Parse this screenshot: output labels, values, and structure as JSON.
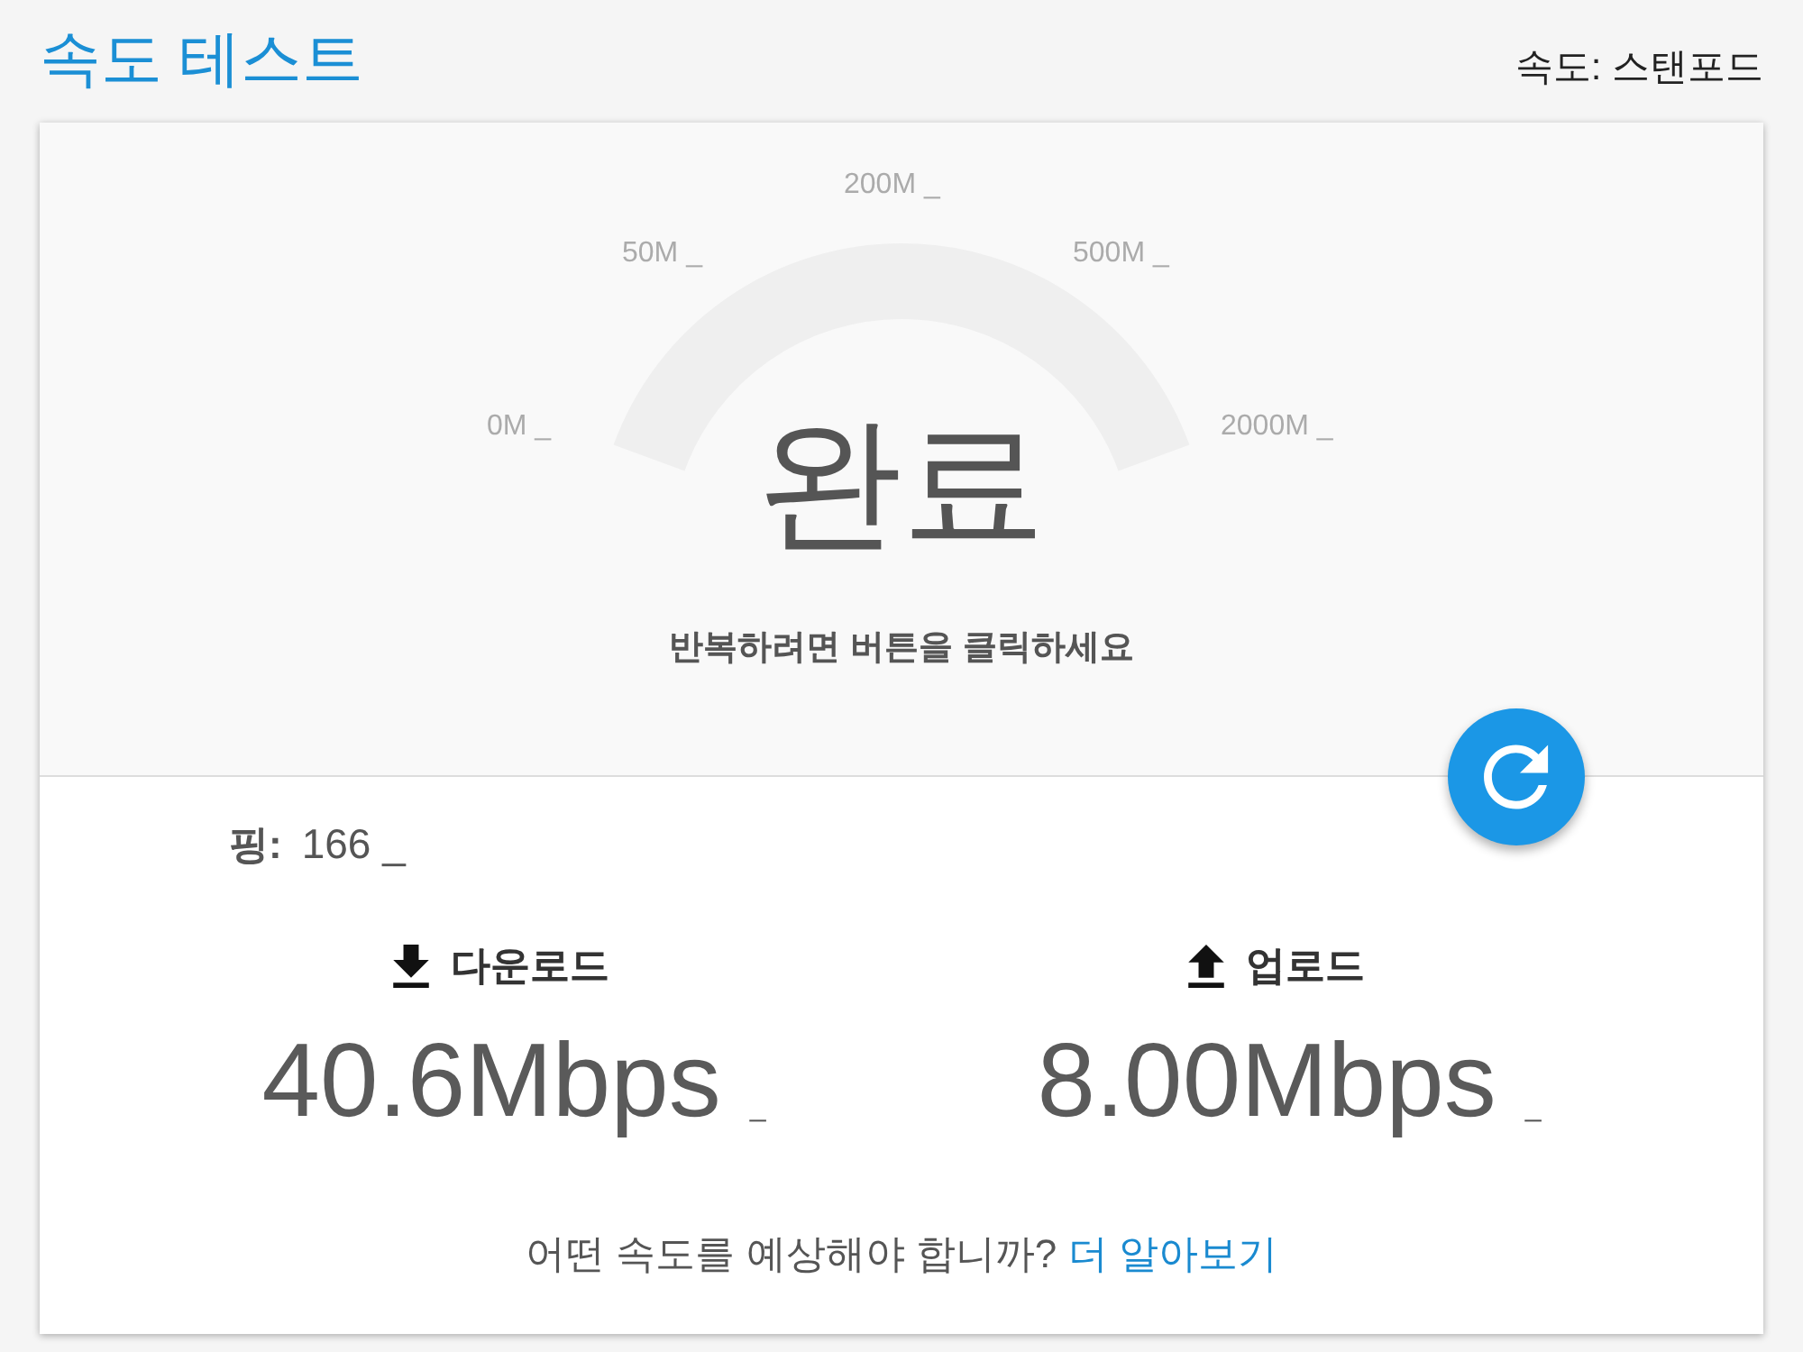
{
  "header": {
    "title": "속도 테스트",
    "server": "속도: 스탠포드"
  },
  "gauge": {
    "scale_labels": [
      "0M _",
      "50M _",
      "200M _",
      "500M _",
      "2000M _"
    ],
    "status": "완료",
    "hint": "반복하려면 버튼을 클릭하세요"
  },
  "ping": {
    "label": "핑:",
    "value": "166 _"
  },
  "results": [
    {
      "kind": "download",
      "label": "다운로드",
      "value": "40.6Mbps",
      "suffix": "_"
    },
    {
      "kind": "upload",
      "label": "업로드",
      "value": "8.00Mbps",
      "suffix": "_"
    }
  ],
  "footer": {
    "question": "어떤 속도를 예상해야 합니까?",
    "link": "더 알아보기"
  }
}
